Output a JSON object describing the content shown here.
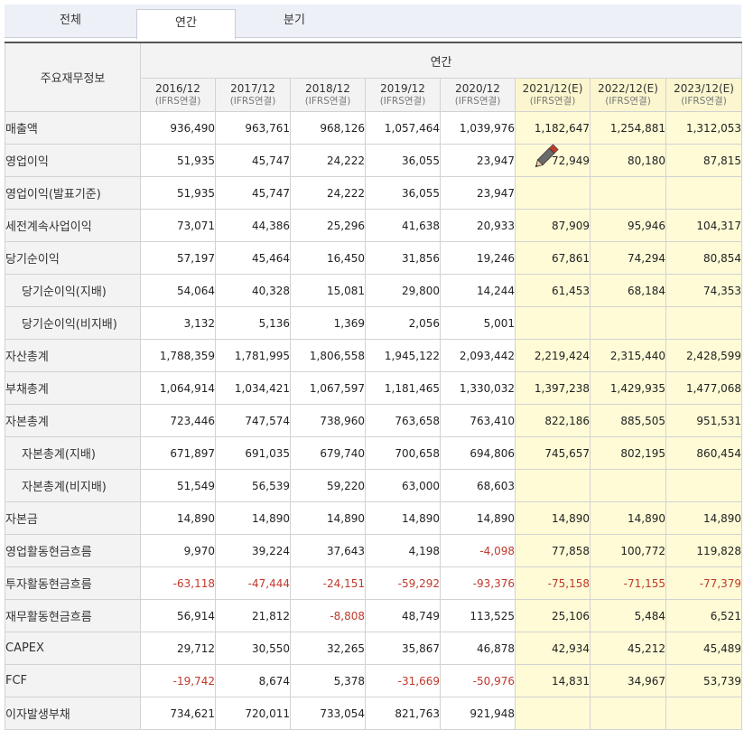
{
  "tabs": [
    {
      "label": "전체",
      "active": false
    },
    {
      "label": "연간",
      "active": true
    },
    {
      "label": "분기",
      "active": false
    }
  ],
  "table": {
    "corner_label": "주요재무정보",
    "group_header": "연간",
    "columns": [
      {
        "period": "2016/12",
        "basis": "(IFRS연결)",
        "estimate": false
      },
      {
        "period": "2017/12",
        "basis": "(IFRS연결)",
        "estimate": false
      },
      {
        "period": "2018/12",
        "basis": "(IFRS연결)",
        "estimate": false
      },
      {
        "period": "2019/12",
        "basis": "(IFRS연결)",
        "estimate": false
      },
      {
        "period": "2020/12",
        "basis": "(IFRS연결)",
        "estimate": false
      },
      {
        "period": "2021/12(E)",
        "basis": "(IFRS연결)",
        "estimate": true
      },
      {
        "period": "2022/12(E)",
        "basis": "(IFRS연결)",
        "estimate": true
      },
      {
        "period": "2023/12(E)",
        "basis": "(IFRS연결)",
        "estimate": true
      }
    ],
    "rows": [
      {
        "label": "매출액",
        "sub": false,
        "values": [
          "936,490",
          "963,761",
          "968,126",
          "1,057,464",
          "1,039,976",
          "1,182,647",
          "1,254,881",
          "1,312,053"
        ]
      },
      {
        "label": "영업이익",
        "sub": false,
        "values": [
          "51,935",
          "45,747",
          "24,222",
          "36,055",
          "23,947",
          "72,949",
          "80,180",
          "87,815"
        ]
      },
      {
        "label": "영업이익(발표기준)",
        "sub": false,
        "values": [
          "51,935",
          "45,747",
          "24,222",
          "36,055",
          "23,947",
          "",
          "",
          ""
        ]
      },
      {
        "label": "세전계속사업이익",
        "sub": false,
        "values": [
          "73,071",
          "44,386",
          "25,296",
          "41,638",
          "20,933",
          "87,909",
          "95,946",
          "104,317"
        ]
      },
      {
        "label": "당기순이익",
        "sub": false,
        "values": [
          "57,197",
          "45,464",
          "16,450",
          "31,856",
          "19,246",
          "67,861",
          "74,294",
          "80,854"
        ]
      },
      {
        "label": "당기순이익(지배)",
        "sub": true,
        "values": [
          "54,064",
          "40,328",
          "15,081",
          "29,800",
          "14,244",
          "61,453",
          "68,184",
          "74,353"
        ]
      },
      {
        "label": "당기순이익(비지배)",
        "sub": true,
        "values": [
          "3,132",
          "5,136",
          "1,369",
          "2,056",
          "5,001",
          "",
          "",
          ""
        ]
      },
      {
        "label": "자산총계",
        "sub": false,
        "values": [
          "1,788,359",
          "1,781,995",
          "1,806,558",
          "1,945,122",
          "2,093,442",
          "2,219,424",
          "2,315,440",
          "2,428,599"
        ]
      },
      {
        "label": "부채총계",
        "sub": false,
        "values": [
          "1,064,914",
          "1,034,421",
          "1,067,597",
          "1,181,465",
          "1,330,032",
          "1,397,238",
          "1,429,935",
          "1,477,068"
        ]
      },
      {
        "label": "자본총계",
        "sub": false,
        "values": [
          "723,446",
          "747,574",
          "738,960",
          "763,658",
          "763,410",
          "822,186",
          "885,505",
          "951,531"
        ]
      },
      {
        "label": "자본총계(지배)",
        "sub": true,
        "values": [
          "671,897",
          "691,035",
          "679,740",
          "700,658",
          "694,806",
          "745,657",
          "802,195",
          "860,454"
        ]
      },
      {
        "label": "자본총계(비지배)",
        "sub": true,
        "values": [
          "51,549",
          "56,539",
          "59,220",
          "63,000",
          "68,603",
          "",
          "",
          ""
        ]
      },
      {
        "label": "자본금",
        "sub": false,
        "values": [
          "14,890",
          "14,890",
          "14,890",
          "14,890",
          "14,890",
          "14,890",
          "14,890",
          "14,890"
        ]
      },
      {
        "label": "영업활동현금흐름",
        "sub": false,
        "values": [
          "9,970",
          "39,224",
          "37,643",
          "4,198",
          "-4,098",
          "77,858",
          "100,772",
          "119,828"
        ]
      },
      {
        "label": "투자활동현금흐름",
        "sub": false,
        "values": [
          "-63,118",
          "-47,444",
          "-24,151",
          "-59,292",
          "-93,376",
          "-75,158",
          "-71,155",
          "-77,379"
        ]
      },
      {
        "label": "재무활동현금흐름",
        "sub": false,
        "values": [
          "56,914",
          "21,812",
          "-8,808",
          "48,749",
          "113,525",
          "25,106",
          "5,484",
          "6,521"
        ]
      },
      {
        "label": "CAPEX",
        "sub": false,
        "values": [
          "29,712",
          "30,550",
          "32,265",
          "35,867",
          "46,878",
          "42,934",
          "45,212",
          "45,489"
        ]
      },
      {
        "label": "FCF",
        "sub": false,
        "values": [
          "-19,742",
          "8,674",
          "5,378",
          "-31,669",
          "-50,976",
          "14,831",
          "34,967",
          "53,739"
        ]
      },
      {
        "label": "이자발생부채",
        "sub": false,
        "values": [
          "734,621",
          "720,011",
          "733,054",
          "821,763",
          "921,948",
          "",
          "",
          ""
        ]
      }
    ]
  },
  "colors": {
    "estimate_bg": "#fefbd6",
    "negative_text": "#c0392b",
    "header_bg": "#f3f3f3"
  },
  "cursor_icon": "pencil-icon"
}
